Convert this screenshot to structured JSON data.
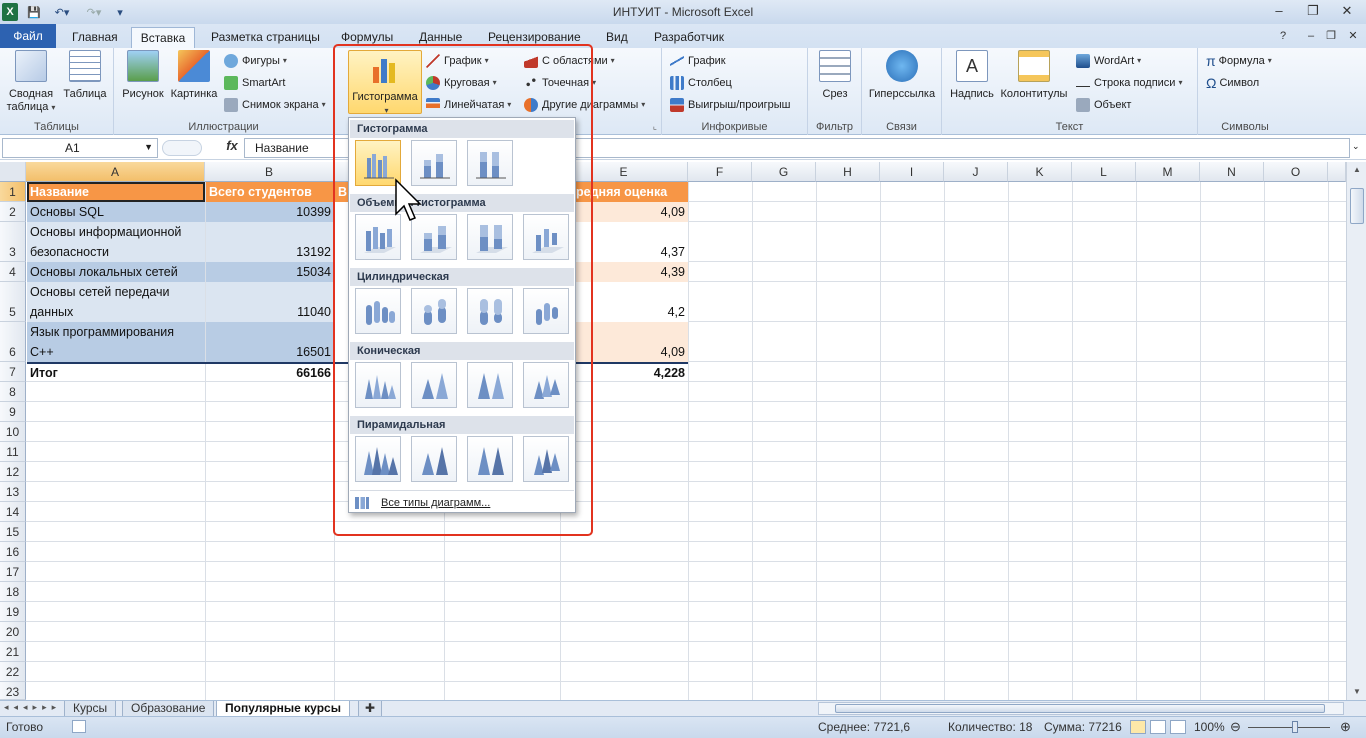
{
  "window": {
    "title": "ИНТУИТ - Microsoft Excel"
  },
  "tabs": [
    "Файл",
    "Главная",
    "Вставка",
    "Разметка страницы",
    "Формулы",
    "Данные",
    "Рецензирование",
    "Вид",
    "Разработчик"
  ],
  "ribbon": {
    "tables": {
      "label": "Таблицы",
      "pivot": "Сводная\nтаблица",
      "table": "Таблица"
    },
    "illustrations": {
      "label": "Иллюстрации",
      "picture": "Рисунок",
      "clipart": "Картинка",
      "shapes": "Фигуры",
      "smartart": "SmartArt",
      "screenshot": "Снимок экрана"
    },
    "charts": {
      "histogram": "Гистограмма",
      "line": "График",
      "pie": "Круговая",
      "bar": "Линейчатая",
      "area": "С областями",
      "scatter": "Точечная",
      "other": "Другие диаграммы"
    },
    "sparklines": {
      "label": "Инфокривые",
      "line": "График",
      "column": "Столбец",
      "winloss": "Выигрыш/проигрыш"
    },
    "filter": {
      "label": "Фильтр",
      "slicer": "Срез"
    },
    "links": {
      "label": "Связи",
      "hyperlink": "Гиперссылка"
    },
    "text": {
      "label": "Текст",
      "textbox": "Надпись",
      "header": "Колонтитулы",
      "wordart": "WordArt",
      "signature": "Строка подписи",
      "object": "Объект"
    },
    "symbols": {
      "label": "Символы",
      "equation": "Формула",
      "symbol": "Символ"
    }
  },
  "formula_bar": {
    "name_box": "A1",
    "fx": "fx",
    "content": "Название"
  },
  "columns": [
    "A",
    "B",
    "C",
    "D",
    "E",
    "F",
    "G",
    "H",
    "I",
    "J",
    "K",
    "L",
    "M",
    "N",
    "O"
  ],
  "rows": [
    "1",
    "2",
    "3",
    "4",
    "5",
    "6",
    "7",
    "8",
    "9",
    "10",
    "11",
    "12",
    "13",
    "14",
    "15",
    "16",
    "17",
    "18",
    "19",
    "20",
    "21",
    "22",
    "23"
  ],
  "sheet": {
    "header": {
      "a": "Название",
      "b": "Всего студентов",
      "c": "В",
      "e": "редняя оценка"
    },
    "data": [
      {
        "a1": "Основы SQL",
        "a2": "",
        "b": "10399",
        "e": "4,09"
      },
      {
        "a1": "Основы информационной",
        "a2": "безопасности",
        "b": "13192",
        "e": "4,37"
      },
      {
        "a1": "Основы локальных сетей",
        "a2": "",
        "b": "15034",
        "e": "4,39"
      },
      {
        "a1": "Основы сетей передачи",
        "a2": "данных",
        "b": "11040",
        "e": "4,2"
      },
      {
        "a1": "Язык программирования",
        "a2": "С++",
        "b": "16501",
        "e": "4,09"
      }
    ],
    "total": {
      "a": "Итог",
      "b": "66166",
      "e": "4,228"
    }
  },
  "dropdown": {
    "sections": [
      "Гистограмма",
      "Объемная гистограмма",
      "Цилиндрическая",
      "Коническая",
      "Пирамидальная"
    ],
    "all_types": "Все типы диаграмм..."
  },
  "sheet_tabs": [
    "Курсы",
    "Образование",
    "Популярные курсы"
  ],
  "status": {
    "ready": "Готово",
    "average": "Среднее: 7721,6",
    "count": "Количество: 18",
    "sum": "Сумма: 77216",
    "zoom": "100%"
  }
}
